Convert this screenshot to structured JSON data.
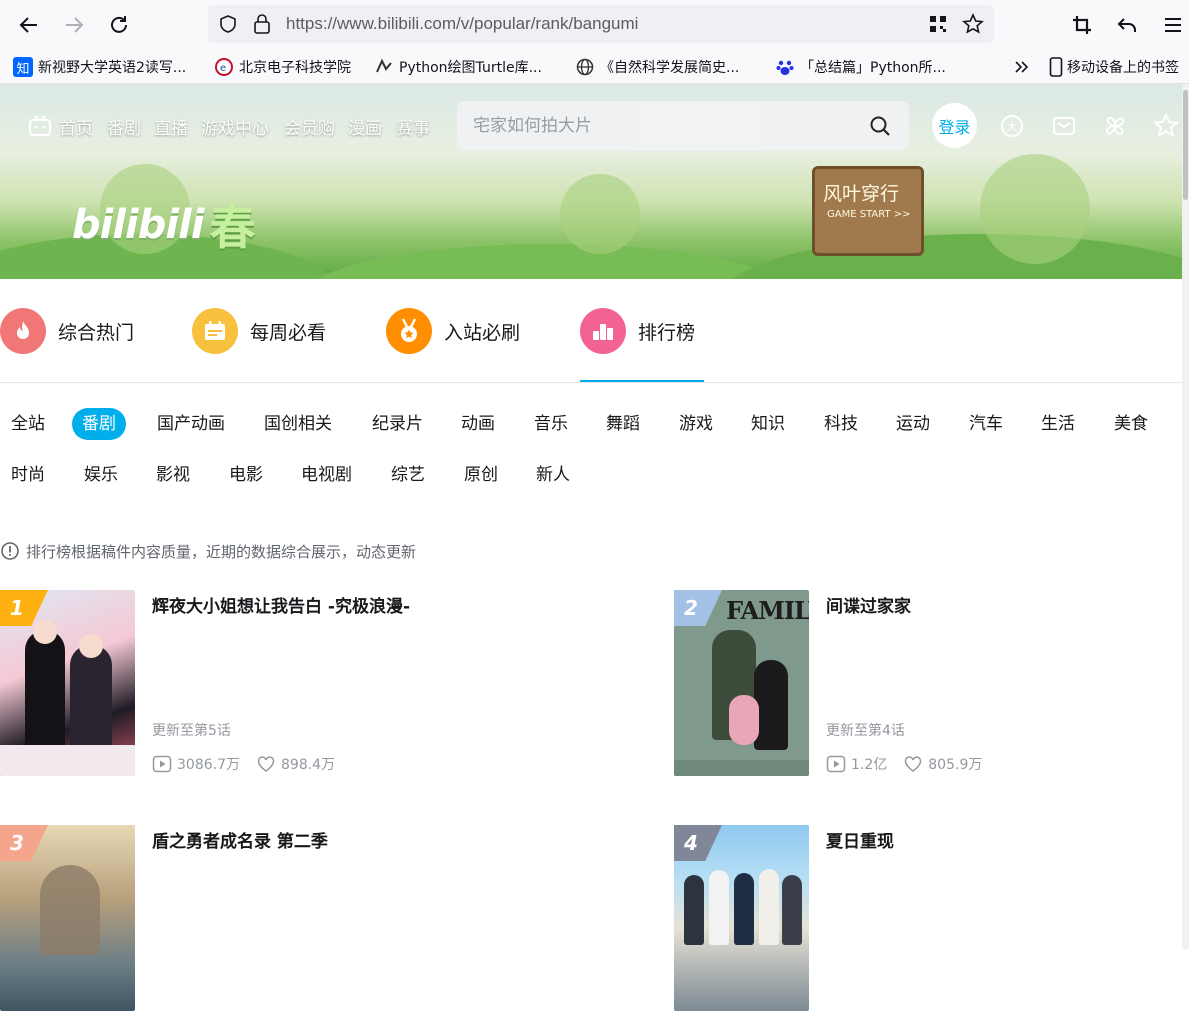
{
  "browser": {
    "url": "https://www.bilibili.com/v/popular/rank/bangumi",
    "bookmarks": [
      {
        "label": "新视野大学英语2读写...",
        "icon": "zhihu-icon"
      },
      {
        "label": "北京电子科技学院",
        "icon": "college-icon"
      },
      {
        "label": "Python绘图Turtle库...",
        "icon": "python-icon"
      },
      {
        "label": "《自然科学发展简史...",
        "icon": "globe-icon"
      },
      {
        "label": "「总结篇」Python所...",
        "icon": "baidu-icon"
      },
      {
        "label": "移动设备上的书签",
        "icon": "mobile-icon"
      }
    ]
  },
  "header": {
    "nav": [
      "首页",
      "番剧",
      "直播",
      "游戏中心",
      "会员购",
      "漫画",
      "赛事"
    ],
    "search_placeholder": "宅家如何拍大片",
    "login": "登录",
    "logo_text": "bilibili",
    "logo_season": "春",
    "sign_title": "风叶穿行",
    "sign_sub": "GAME START >>"
  },
  "tabs": [
    {
      "label": "综合热门",
      "color": "#f07775",
      "icon": "flame-icon"
    },
    {
      "label": "每周必看",
      "color": "#f7c03d",
      "icon": "calendar-icon"
    },
    {
      "label": "入站必刷",
      "color": "#ff8f00",
      "icon": "medal-icon"
    },
    {
      "label": "排行榜",
      "color": "#f36392",
      "icon": "ranking-icon"
    }
  ],
  "categories_row1": [
    "全站",
    "番剧",
    "国产动画",
    "国创相关",
    "纪录片",
    "动画",
    "音乐",
    "舞蹈",
    "游戏",
    "知识",
    "科技",
    "运动",
    "汽车",
    "生活",
    "美食"
  ],
  "categories_row2": [
    "时尚",
    "娱乐",
    "影视",
    "电影",
    "电视剧",
    "综艺",
    "原创",
    "新人"
  ],
  "active_category": "番剧",
  "notice": "排行榜根据稿件内容质量，近期的数据综合展示，动态更新",
  "items": [
    {
      "rank": "1",
      "title": "辉夜大小姐想让我告白 -究极浪漫-",
      "update": "更新至第5话",
      "plays": "3086.7万",
      "likes": "898.4万",
      "badge_color": "#ffb112"
    },
    {
      "rank": "2",
      "title": "间谍过家家",
      "update": "更新至第4话",
      "plays": "1.2亿",
      "likes": "805.9万",
      "badge_color": "#a3c1e5"
    },
    {
      "rank": "3",
      "title": "盾之勇者成名录 第二季",
      "update": "",
      "plays": "",
      "likes": "",
      "badge_color": "#f4a58b"
    },
    {
      "rank": "4",
      "title": "夏日重现",
      "update": "",
      "plays": "",
      "likes": "",
      "badge_color": "#7f8799"
    }
  ]
}
